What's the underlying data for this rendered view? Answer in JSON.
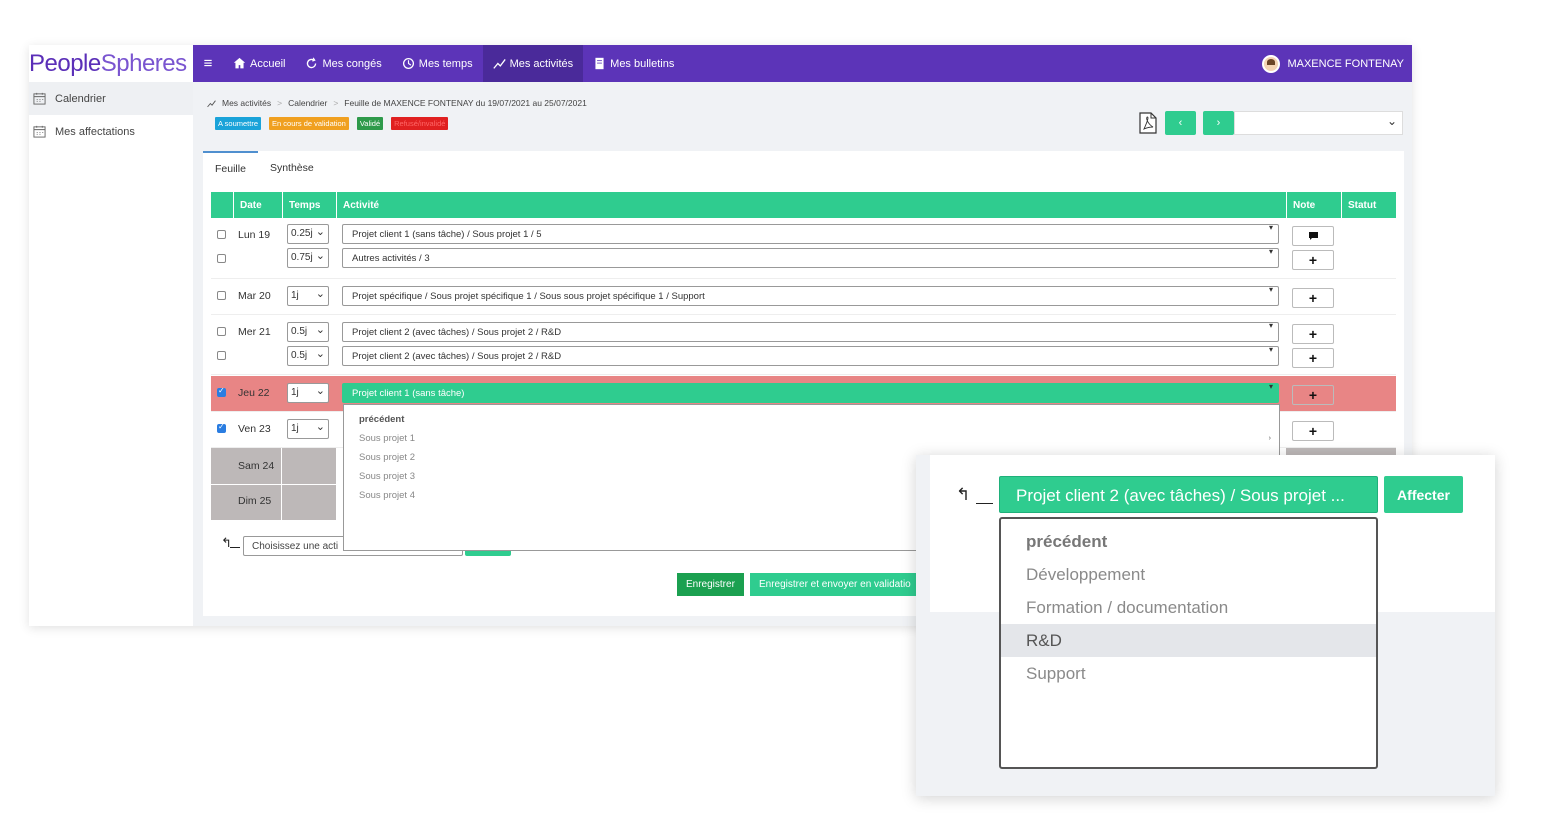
{
  "logo": {
    "p1": "Pe",
    "p2": "ople",
    "p3": "Spheres"
  },
  "topnav": {
    "items": [
      {
        "label": "Accueil",
        "icon": "home-icon"
      },
      {
        "label": "Mes congés",
        "icon": "refresh-icon"
      },
      {
        "label": "Mes temps",
        "icon": "clock-icon"
      },
      {
        "label": "Mes activités",
        "icon": "chart-line-icon"
      },
      {
        "label": "Mes bulletins",
        "icon": "document-icon"
      }
    ],
    "user": "MAXENCE FONTENAY"
  },
  "sidebar": {
    "items": [
      {
        "label": "Calendrier"
      },
      {
        "label": "Mes affectations"
      }
    ]
  },
  "breadcrumb": {
    "a": "Mes activités",
    "b": "Calendrier",
    "c": "Feuille de MAXENCE FONTENAY du 19/07/2021 au 25/07/2021"
  },
  "badges": [
    {
      "label": "A soumettre",
      "color": "#1aa3d9"
    },
    {
      "label": "En cours de validation",
      "color": "#f0a020"
    },
    {
      "label": "Validé",
      "color": "#2e9a4a"
    },
    {
      "label": "Refusé/invalidé",
      "color": "#e02020"
    }
  ],
  "tabs": [
    "Feuille",
    "Synthèse"
  ],
  "table": {
    "headers": {
      "date": "Date",
      "temps": "Temps",
      "activite": "Activité",
      "note": "Note",
      "statut": "Statut"
    },
    "rows": [
      {
        "day": "Lun 19",
        "t1": "0.25j",
        "a1": "Projet client 1 (sans tâche) / Sous projet 1 / 5",
        "t2": "0.75j",
        "a2": "Autres activités / 3"
      },
      {
        "day": "Mar 20",
        "t1": "1j",
        "a1": "Projet spécifique / Sous projet spécifique 1 / Sous sous projet spécifique 1 / Support"
      },
      {
        "day": "Mer 21",
        "t1": "0.5j",
        "a1": "Projet client 2 (avec tâches) / Sous projet 2 / R&D",
        "t2": "0.5j",
        "a2": "Projet client 2 (avec tâches) / Sous projet 2 / R&D"
      },
      {
        "day": "Jeu 22",
        "t1": "1j",
        "a1": "Projet client 1 (sans tâche)"
      },
      {
        "day": "Ven 23",
        "t1": "1j"
      },
      {
        "day": "Sam 24"
      },
      {
        "day": "Dim 25"
      }
    ]
  },
  "dropdown": {
    "items": [
      "précédent",
      "Sous projet 1",
      "Sous projet 2",
      "Sous projet 3",
      "Sous projet 4"
    ]
  },
  "footer": {
    "input_placeholder": "Choisissez une acti",
    "save": "Enregistrer",
    "save_send": "Enregistrer et envoyer en validatio"
  },
  "zoom": {
    "select": "Projet client 2 (avec tâches) / Sous projet ...",
    "button": "Affecter",
    "items": [
      "précédent",
      "Développement",
      "Formation / documentation",
      "R&D",
      "Support"
    ]
  },
  "colors": {
    "primary": "#5c34b8",
    "accent": "#2fcc8f",
    "selected_row": "#e88585"
  }
}
